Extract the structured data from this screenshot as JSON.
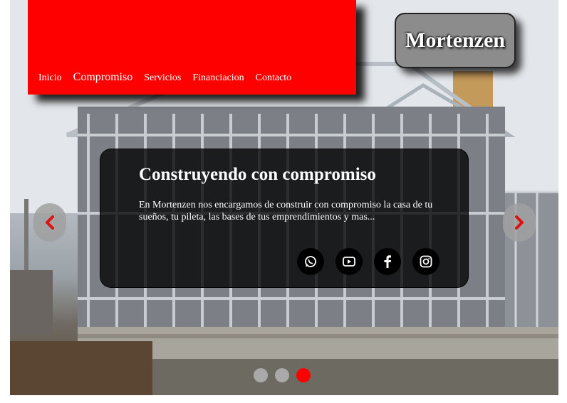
{
  "header": {
    "nav": [
      {
        "label": "Inicio"
      },
      {
        "label": "Compromiso"
      },
      {
        "label": "Servicios"
      },
      {
        "label": "Financiacion"
      },
      {
        "label": "Contacto"
      }
    ],
    "accent_color": "#ff0000"
  },
  "brand": {
    "name": "Mortenzen"
  },
  "slide": {
    "title": "Construyendo con compromiso",
    "text": "En Mortenzen nos encargamos de construir con compromiso la casa de tu sueños, tu pileta, las bases de tus emprendimientos y mas...",
    "socials": [
      {
        "icon": "whatsapp-icon"
      },
      {
        "icon": "youtube-icon"
      },
      {
        "icon": "facebook-icon"
      },
      {
        "icon": "instagram-icon"
      }
    ]
  },
  "carousel": {
    "prev_icon": "chevron-left-icon",
    "next_icon": "chevron-right-icon",
    "slide_count": 3,
    "active_index": 2
  }
}
